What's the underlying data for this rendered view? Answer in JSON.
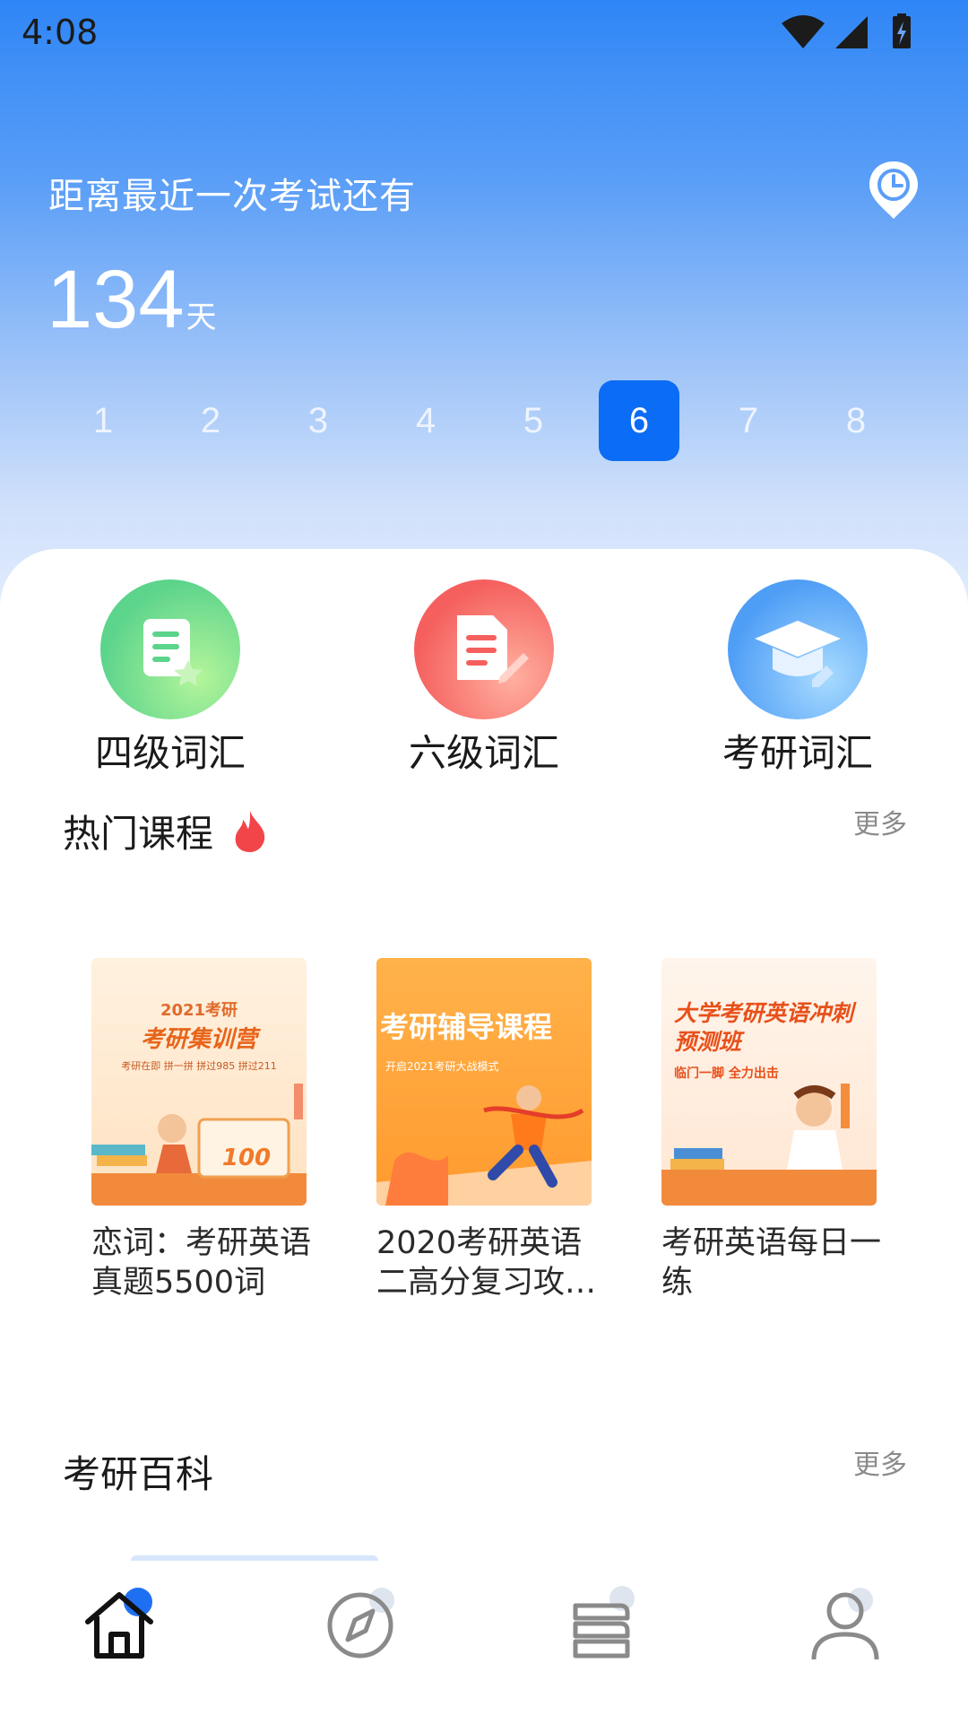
{
  "status": {
    "time": "4:08"
  },
  "countdown": {
    "label": "距离最近一次考试还有",
    "value": "134",
    "unit": "天"
  },
  "day_selector": {
    "days": [
      "1",
      "2",
      "3",
      "4",
      "5",
      "6",
      "7",
      "8"
    ],
    "selected": "6"
  },
  "categories": [
    {
      "label": "四级词汇",
      "icon": "note-star-icon"
    },
    {
      "label": "六级词汇",
      "icon": "document-pen-icon"
    },
    {
      "label": "考研词汇",
      "icon": "graduation-cap-icon"
    }
  ],
  "hot_courses": {
    "title": "热门课程",
    "more": "更多",
    "items": [
      {
        "title": "恋词：考研英语真题5500词",
        "cover_title": "考研集训营",
        "cover_sub": "2021考研",
        "cover_line": "考研在即 拼一拼 拼过985 拼过211",
        "cover_badge": "100"
      },
      {
        "title": "2020考研英语二高分复习攻…",
        "cover_title": "考研辅导课程",
        "cover_sub": "开启2021考研大战模式"
      },
      {
        "title": "考研英语每日一练",
        "cover_title": "大学考研英语冲刺预测班",
        "cover_sub": "临门一脚 全力出击"
      }
    ]
  },
  "encyclopedia": {
    "title": "考研百科",
    "more": "更多"
  },
  "tabbar": {
    "items": [
      "home-icon",
      "compass-icon",
      "books-icon",
      "profile-icon"
    ]
  },
  "colors": {
    "accent": "#0b6cf5",
    "hero_top": "#2f86f6"
  }
}
